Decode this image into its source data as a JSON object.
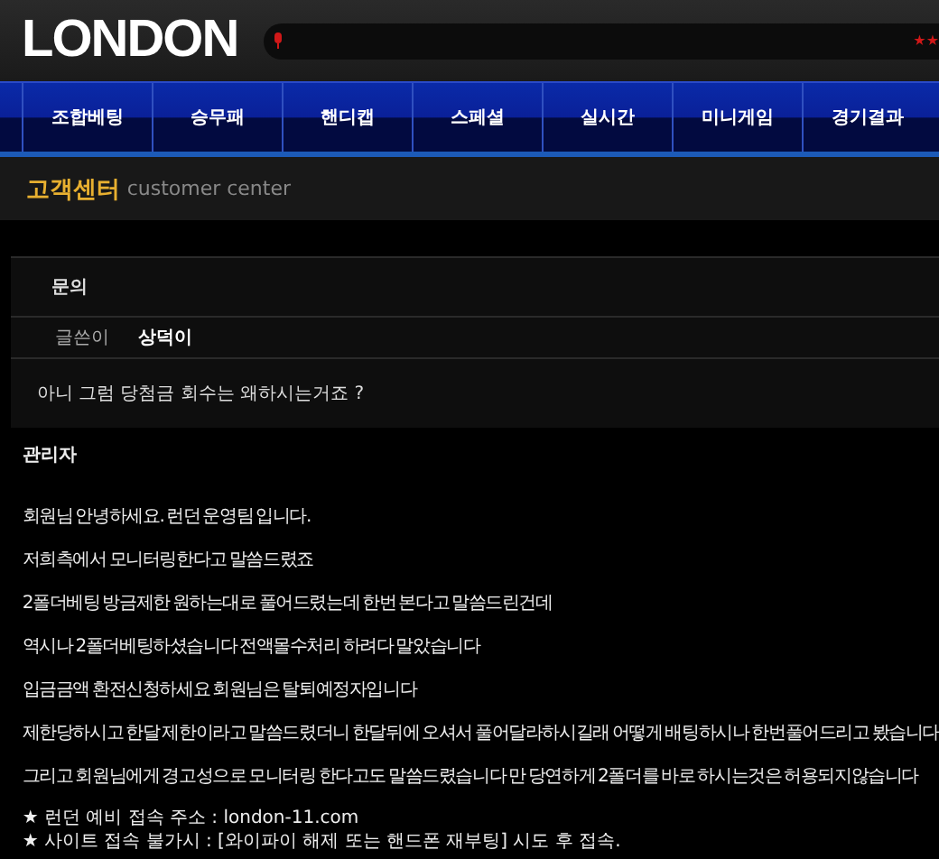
{
  "logo": "LONDON",
  "ticker": {
    "text": "★★"
  },
  "nav": [
    {
      "label": "조합베팅"
    },
    {
      "label": "승무패"
    },
    {
      "label": "핸디캡"
    },
    {
      "label": "스페셜"
    },
    {
      "label": "실시간"
    },
    {
      "label": "미니게임"
    },
    {
      "label": "경기결과"
    }
  ],
  "section": {
    "title": "고객센터",
    "subtitle": "customer center"
  },
  "post": {
    "category": "문의",
    "author_label": "글쓴이",
    "author": "상덕이",
    "question": "아니 그럼 당첨금 회수는 왜하시는거죠 ?"
  },
  "reply": {
    "author": "관리자",
    "paragraphs": [
      "회원님 안녕하세요. 런던 운영팀 입니다.",
      "저희측에서 모니터링한다고 말씀드렸죠",
      "2폴더베팅 방금제한 원하는대로 풀어드렸는데 한번 본다고 말씀드린건데",
      "역시나 2폴더베팅하셨습니다 전액몰수처리 하려다 말았습니다",
      "입금금액 환전신청하세요 회원님은 탈퇴예정자입니다",
      "제한당하시고 한달 제한이라고 말씀드렸더니 한달뒤에 오셔서 풀어달라하시길래 어떻게 배팅하시나 한번풀어드리고 봤습니다",
      "그리고 회원님에게 경고성으로 모니터링 한다고도 말씀드렸습니다 만 당연하게 2폴더를 바로 하시는것은 허용되지않습니다"
    ],
    "notices": [
      "★ 런던 예비 접속 주소 : london-11.com",
      "★ 사이트 접속 불가시 : [와이파이 해제 또는 핸드폰 재부팅] 시도 후 접속."
    ]
  }
}
